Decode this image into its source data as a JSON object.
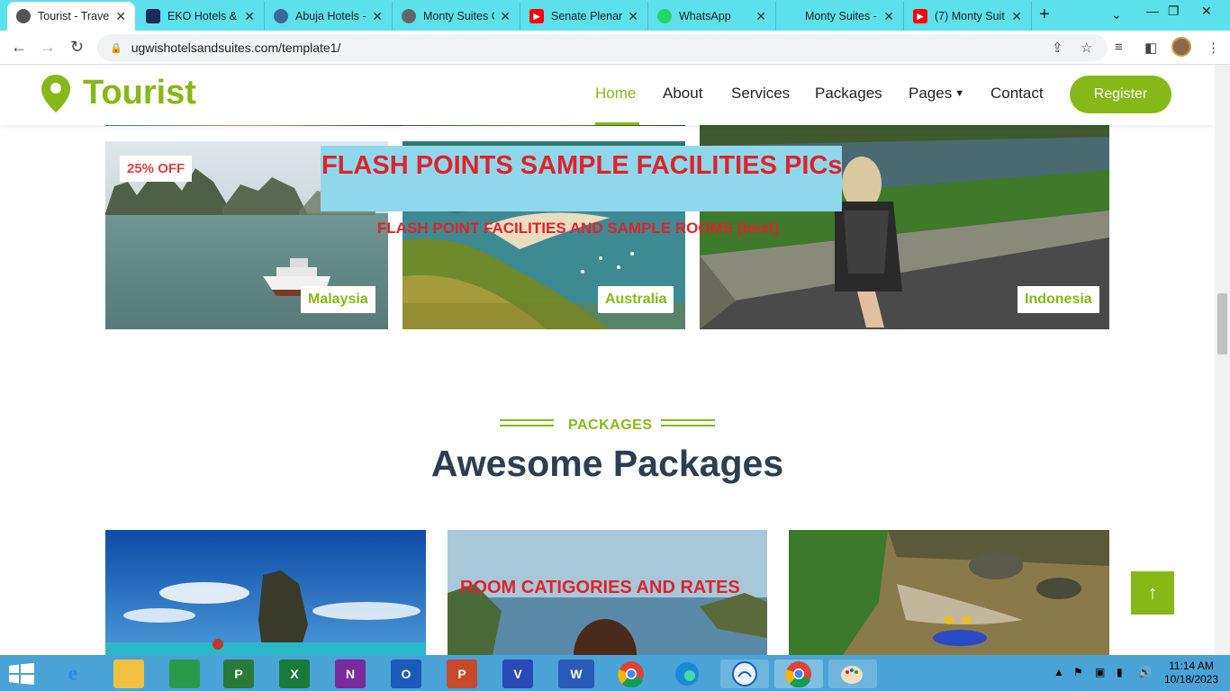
{
  "browser": {
    "tabs": [
      {
        "title": "Tourist - Travel",
        "favicon": "tourist-favicon",
        "active": true
      },
      {
        "title": "EKO Hotels & ",
        "favicon": "eko-favicon"
      },
      {
        "title": "Abuja Hotels - ",
        "favicon": "abuja-favicon"
      },
      {
        "title": "Monty Suites C",
        "favicon": "globe-icon"
      },
      {
        "title": "Senate Plenary",
        "favicon": "youtube-icon"
      },
      {
        "title": "WhatsApp",
        "favicon": "whatsapp-icon"
      },
      {
        "title": "Monty Suites - ",
        "favicon": "none"
      },
      {
        "title": "(7) Monty Suit",
        "favicon": "youtube-icon"
      }
    ],
    "new_tab": "+",
    "url": "ugwishotelsandsuites.com/template1/"
  },
  "site": {
    "logo": "Tourist",
    "nav": [
      "Home",
      "About",
      "Services",
      "Packages",
      "Pages",
      "Contact"
    ],
    "register": "Register",
    "discount": "25% OFF",
    "destinations": [
      "Malaysia",
      "Australia",
      "Indonesia"
    ],
    "flash_title": "FLASH POINTS SAMPLE FACILITIES PICs",
    "flash_sub": "FLASH POINT FACILITIES AND SAMPLE ROOMS (best)",
    "packages_label": "PACKAGES",
    "packages_title": "Awesome Packages",
    "room_categories": "ROOM CATIGORIES AND RATES",
    "back_to_top": "↑"
  },
  "taskbar": {
    "apps": [
      "Internet Explorer",
      "File Explorer",
      "Store",
      "Project",
      "Excel",
      "OneNote",
      "Outlook",
      "PowerPoint",
      "Visio",
      "Word",
      "Chrome",
      "Edge",
      "Photos",
      "Chrome",
      "Paint"
    ],
    "time": "11:14 AM",
    "date": "10/18/2023"
  },
  "colors": {
    "accent": "#86b817",
    "tabbar": "#5ce0ec",
    "flash_red": "#e0222a",
    "taskbar": "#4aa3d6"
  }
}
